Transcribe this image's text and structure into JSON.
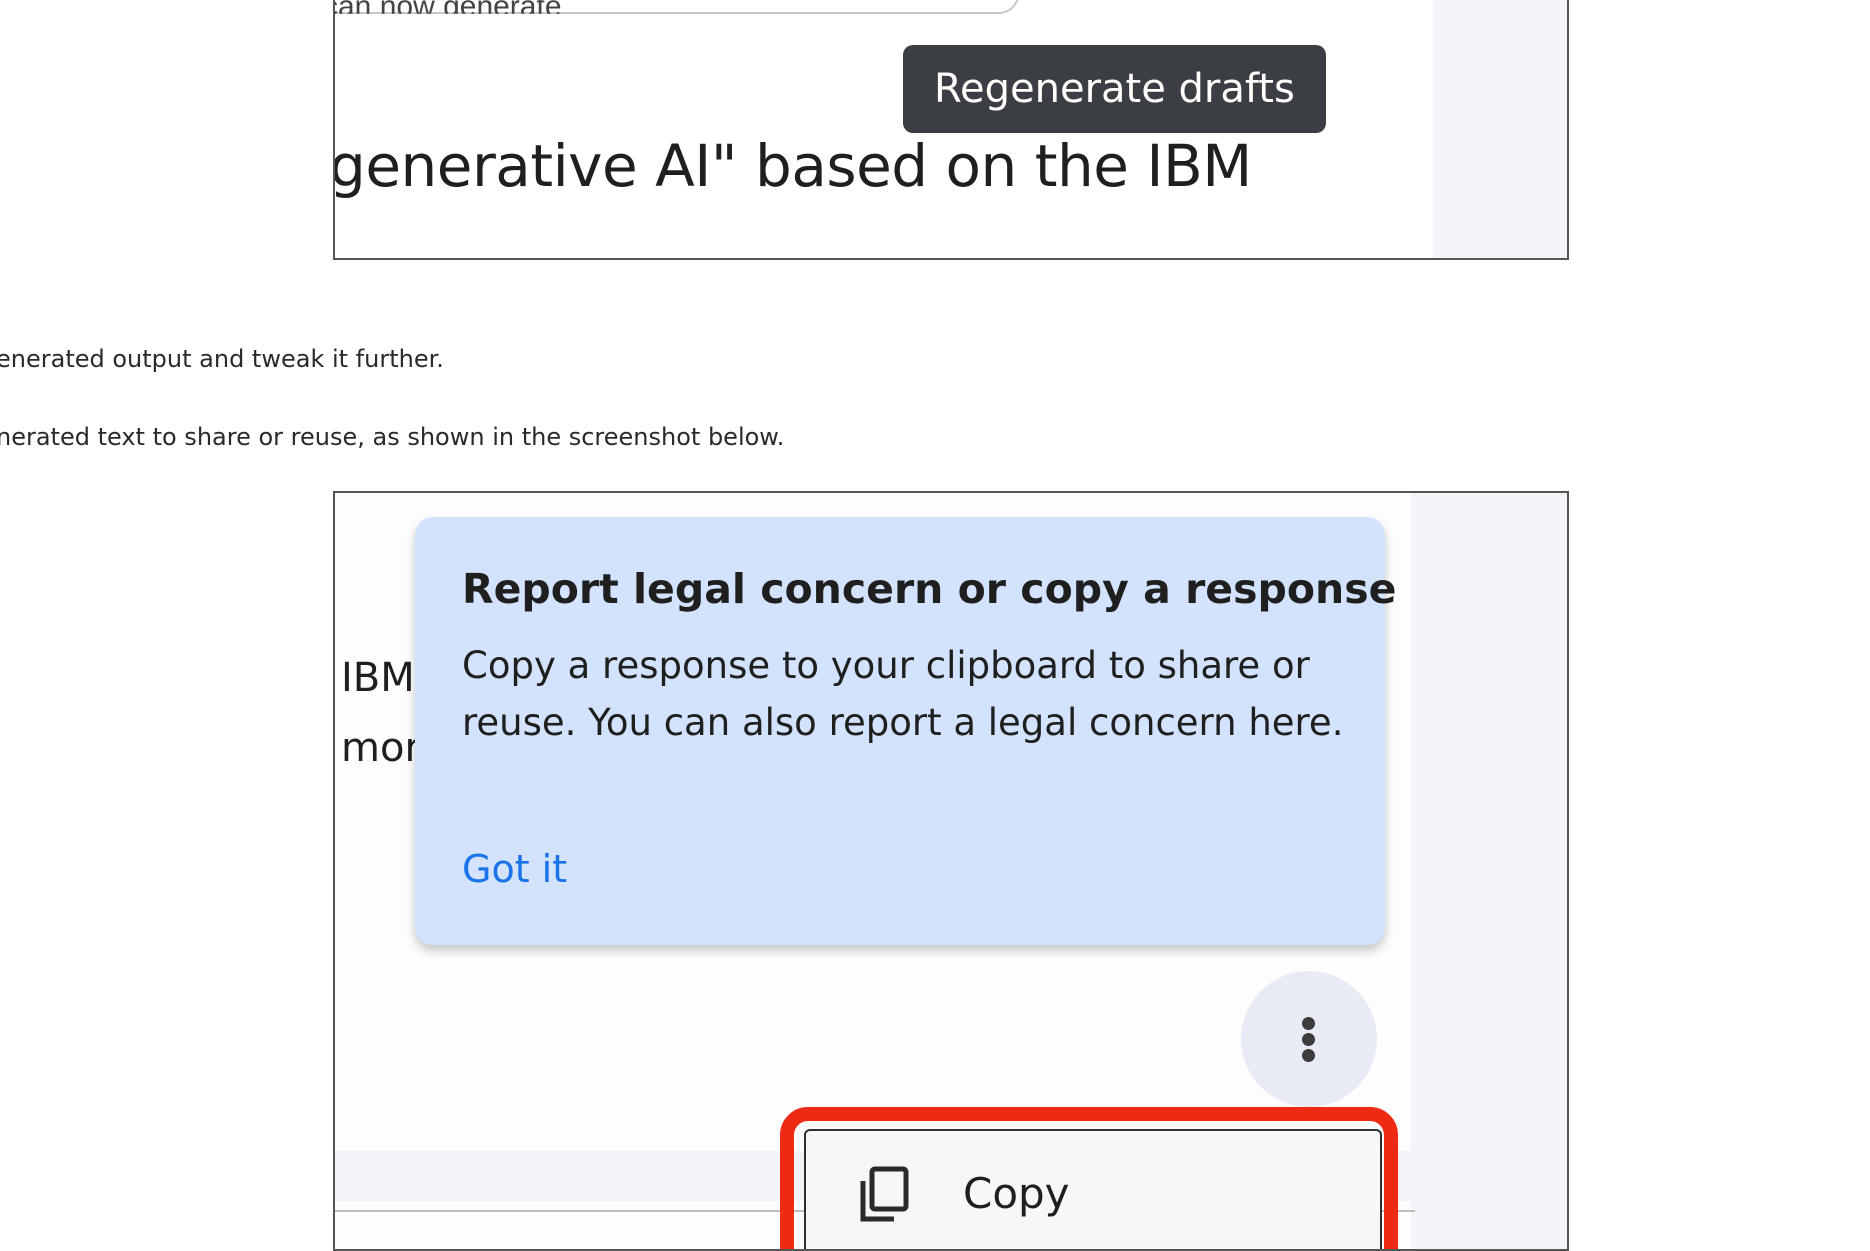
{
  "top_screenshot": {
    "input_fragment": "can now generate",
    "tooltip": "Regenerate drafts",
    "response_fragment": "generative AI\" based on the IBM"
  },
  "article": {
    "line1": "enerated output and tweak it further.",
    "line2": "nerated text to share or reuse, as shown in the screenshot below."
  },
  "bottom_screenshot": {
    "cut_line1": "IBM",
    "cut_line2": "mor",
    "callout": {
      "title": "Report legal concern or copy a response",
      "body": "Copy a response to your clipboard to share or reuse. You can also report a legal concern here.",
      "action": "Got it"
    },
    "more_button_icon": "more-vert-icon",
    "menu": {
      "copy_icon": "copy-icon",
      "copy_label": "Copy"
    }
  },
  "colors": {
    "highlight_red": "#ee2a14",
    "callout_blue": "#d3e3fd",
    "link_blue": "#1a73e8",
    "tooltip_dark": "#3b3f44"
  }
}
